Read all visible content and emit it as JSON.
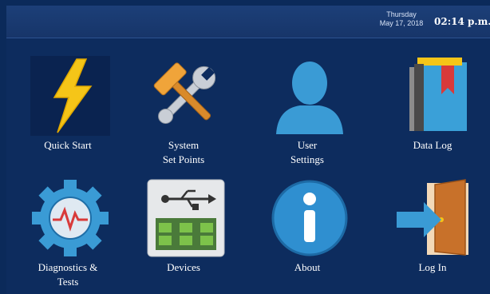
{
  "status_bar": {
    "day": "Thursday",
    "date": "May 17, 2018",
    "time": "02:14 p.m."
  },
  "tiles": [
    {
      "lines": [
        "Quick Start"
      ]
    },
    {
      "lines": [
        "System",
        "Set Points"
      ]
    },
    {
      "lines": [
        "User",
        "Settings"
      ]
    },
    {
      "lines": [
        "Data Log"
      ]
    },
    {
      "lines": [
        "Diagnostics &",
        "Tests"
      ]
    },
    {
      "lines": [
        "Devices"
      ]
    },
    {
      "lines": [
        "About"
      ]
    },
    {
      "lines": [
        "Log In"
      ]
    }
  ],
  "colors": {
    "background": "#0d2c5e",
    "status_bar": "#1c3f78",
    "lightning": "#f5c518",
    "user_icon": "#3a9bd5",
    "book_red": "#d83a3a",
    "door_brown": "#c8712a"
  }
}
